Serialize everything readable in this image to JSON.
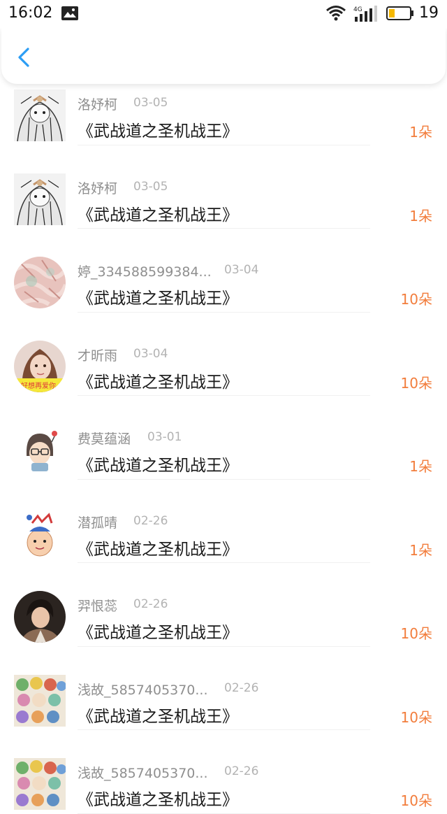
{
  "status_bar": {
    "time": "16:02",
    "network": "4G",
    "battery": "19"
  },
  "header": {
    "back_icon": "chevron-left-icon",
    "accent_color": "#2b9df4"
  },
  "accent_color": "#f27d3c",
  "rows": [
    {
      "name": "洛妤柯",
      "date": "03-05",
      "book": "《武战道之圣机战王》",
      "amount": "1朵",
      "avatar": "anime-sketch"
    },
    {
      "name": "洛妤柯",
      "date": "03-05",
      "book": "《武战道之圣机战王》",
      "amount": "1朵",
      "avatar": "anime-sketch"
    },
    {
      "name": "婷_334588599384...",
      "date": "03-04",
      "book": "《武战道之圣机战王》",
      "amount": "10朵",
      "avatar": "pink-texture"
    },
    {
      "name": "才昕雨",
      "date": "03-04",
      "book": "《武战道之圣机战王》",
      "amount": "10朵",
      "avatar": "girl-photo"
    },
    {
      "name": "费莫蕴涵",
      "date": "03-01",
      "book": "《武战道之圣机战王》",
      "amount": "1朵",
      "avatar": "cartoon-glasses"
    },
    {
      "name": "潜孤晴",
      "date": "02-26",
      "book": "《武战道之圣机战王》",
      "amount": "1朵",
      "avatar": "cartoon-bird-head"
    },
    {
      "name": "羿恨蕊",
      "date": "02-26",
      "book": "《武战道之圣机战王》",
      "amount": "10朵",
      "avatar": "man-photo"
    },
    {
      "name": "浅故_5857405370...",
      "date": "02-26",
      "book": "《武战道之圣机战王》",
      "amount": "10朵",
      "avatar": "anime-group"
    },
    {
      "name": "浅故_5857405370...",
      "date": "02-26",
      "book": "《武战道之圣机战王》",
      "amount": "10朵",
      "avatar": "anime-group"
    }
  ]
}
